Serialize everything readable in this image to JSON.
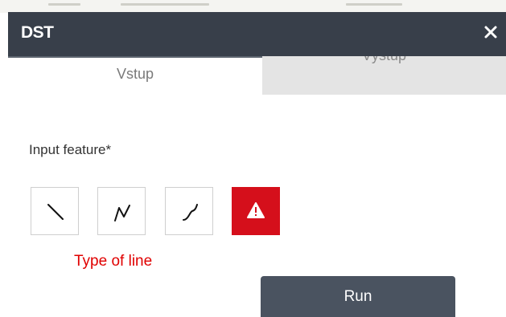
{
  "dialog": {
    "title": "DST",
    "close_icon": "close-icon"
  },
  "tabs": [
    {
      "label": "Vstup",
      "active": true
    },
    {
      "label": "Výstup",
      "active": false
    }
  ],
  "input": {
    "label": "Input feature*"
  },
  "tools": [
    {
      "icon": "straight-line-icon"
    },
    {
      "icon": "polyline-icon"
    },
    {
      "icon": "freehand-curve-icon"
    },
    {
      "icon": "warning-icon"
    }
  ],
  "annotation": {
    "text": "Type of line",
    "color": "#e00000"
  },
  "actions": {
    "run_label": "Run"
  },
  "colors": {
    "titlebar": "#383f4a",
    "run_button": "#4a5360",
    "warning": "#d50f1b",
    "inactive_tab": "#e4e4e4"
  }
}
